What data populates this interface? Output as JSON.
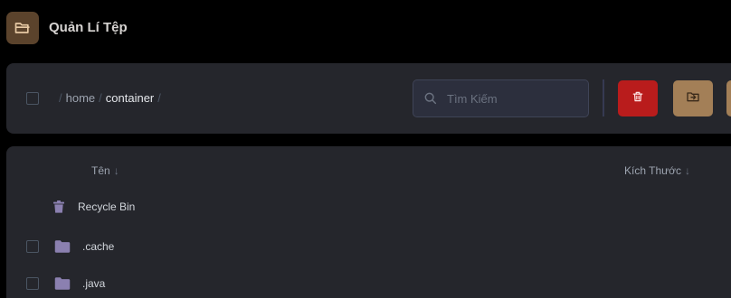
{
  "header": {
    "app_title": "Quản Lí Tệp",
    "app_icon": "folder-open-icon"
  },
  "toolbar": {
    "breadcrumb": [
      {
        "label": "home"
      },
      {
        "label": "container"
      }
    ],
    "search": {
      "placeholder": "Tìm Kiếm"
    },
    "buttons": {
      "delete_icon": "trash-icon",
      "move_icon": "folder-move-icon"
    }
  },
  "table": {
    "columns": {
      "name": "Tên",
      "size": "Kích Thước",
      "sort_glyph": "↓"
    },
    "rows": [
      {
        "name": "Recycle Bin",
        "icon": "trash-icon",
        "has_checkbox": false
      },
      {
        "name": ".cache",
        "icon": "folder-icon",
        "has_checkbox": true
      },
      {
        "name": ".java",
        "icon": "folder-icon",
        "has_checkbox": true
      }
    ]
  },
  "colors": {
    "background": "#000000",
    "card": "#25262c",
    "danger": "#b91c1c",
    "accent": "#a37f57",
    "icon": "#8b80b0"
  }
}
